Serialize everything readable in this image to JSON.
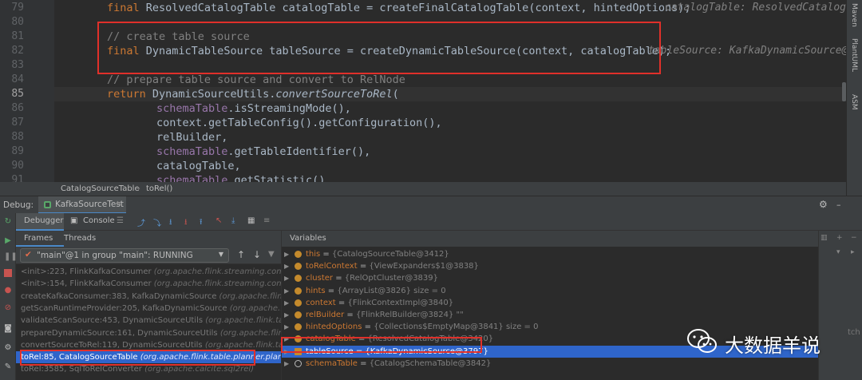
{
  "editor": {
    "lines": [
      {
        "num": "79",
        "indent": 0,
        "tokens": [
          [
            "k",
            "final "
          ],
          [
            "t",
            "ResolvedCatalogTable catalogTable = createFinalCatalogTable(context, hintedOptions);"
          ]
        ]
      },
      {
        "num": "80",
        "indent": 0,
        "tokens": []
      },
      {
        "num": "81",
        "indent": 0,
        "tokens": [
          [
            "c",
            "// create table source"
          ]
        ]
      },
      {
        "num": "82",
        "indent": 0,
        "tokens": [
          [
            "k",
            "final "
          ],
          [
            "t",
            "DynamicTableSource tableSource = createDynamicTableSource(context, catalogTable);"
          ]
        ]
      },
      {
        "num": "83",
        "indent": 0,
        "tokens": []
      },
      {
        "num": "84",
        "indent": 0,
        "tokens": [
          [
            "c",
            "// prepare table source and convert to RelNode"
          ]
        ]
      },
      {
        "num": "85",
        "indent": 0,
        "tokens": [
          [
            "k",
            "return "
          ],
          [
            "t",
            "DynamicSourceUtils."
          ],
          [
            "it",
            "convertSourceToRel"
          ],
          [
            "t",
            "("
          ]
        ]
      },
      {
        "num": "86",
        "indent": 1,
        "tokens": [
          [
            "pv",
            "schemaTable"
          ],
          [
            "t",
            ".isStreamingMode(),"
          ]
        ]
      },
      {
        "num": "87",
        "indent": 1,
        "tokens": [
          [
            "t",
            "context.getTableConfig().getConfiguration(),"
          ]
        ]
      },
      {
        "num": "88",
        "indent": 1,
        "tokens": [
          [
            "t",
            "relBuilder,"
          ]
        ]
      },
      {
        "num": "89",
        "indent": 1,
        "tokens": [
          [
            "pv",
            "schemaTable"
          ],
          [
            "t",
            ".getTableIdentifier(),"
          ]
        ]
      },
      {
        "num": "90",
        "indent": 1,
        "tokens": [
          [
            "t",
            "catalogTable,"
          ]
        ]
      },
      {
        "num": "91",
        "indent": 1,
        "tokens": [
          [
            "pv",
            "schemaTable"
          ],
          [
            "t",
            ".getStatistic()"
          ]
        ]
      }
    ],
    "current_line": "85",
    "hint_79": "catalogTable: ResolvedCatalogTa",
    "hint_82": "tableSource: KafkaDynamicSource@37",
    "breadcrumb_class": "CatalogSourceTable",
    "breadcrumb_method": "toRel()",
    "right_tools": [
      "Maven",
      "PlantUML",
      "ASM"
    ]
  },
  "debug": {
    "label": "Debug:",
    "session_tab": "KafkaSourceTest",
    "tab_debugger": "Debugger",
    "tab_console": "Console",
    "frames_tab": "Frames",
    "threads_tab": "Threads",
    "thread_selector": "\"main\"@1 in group \"main\": RUNNING",
    "variables_title": "Variables",
    "right_label": "tch"
  },
  "frames": [
    {
      "loc": "<init>:223, FlinkKafkaConsumer",
      "pkg": "(org.apache.flink.streaming.connect"
    },
    {
      "loc": "<init>:154, FlinkKafkaConsumer",
      "pkg": "(org.apache.flink.streaming.connect"
    },
    {
      "loc": "createKafkaConsumer:383, KafkaDynamicSource",
      "pkg": "(org.apache.flink.s"
    },
    {
      "loc": "getScanRuntimeProvider:205, KafkaDynamicSource",
      "pkg": "(org.apache.flink.s"
    },
    {
      "loc": "validateScanSource:453, DynamicSourceUtils",
      "pkg": "(org.apache.flink.tabl"
    },
    {
      "loc": "prepareDynamicSource:161, DynamicSourceUtils",
      "pkg": "(org.apache.flink.ta"
    },
    {
      "loc": "convertSourceToRel:119, DynamicSourceUtils",
      "pkg": "(org.apache.flink.tabl"
    },
    {
      "loc": "toRel:85, CatalogSourceTable",
      "pkg": "(org.apache.flink.table.planner.plan.sc"
    },
    {
      "loc": "toRel:3585, SqlToRelConverter",
      "pkg": "(org.apache.calcite.sql2rel)"
    }
  ],
  "selected_frame": 7,
  "variables": [
    {
      "name": "this",
      "value": "{CatalogSourceTable@3412}",
      "icon": "field"
    },
    {
      "name": "toRelContext",
      "value": "{ViewExpanders$1@3838}",
      "icon": "param"
    },
    {
      "name": "cluster",
      "value": "{RelOptCluster@3839}",
      "icon": "field"
    },
    {
      "name": "hints",
      "value": "{ArrayList@3826}  size = 0",
      "icon": "field"
    },
    {
      "name": "context",
      "value": "{FlinkContextImpl@3840}",
      "icon": "field"
    },
    {
      "name": "relBuilder",
      "value": "{FlinkRelBuilder@3824} \"\"",
      "icon": "field"
    },
    {
      "name": "hintedOptions",
      "value": "{Collections$EmptyMap@3841}  size = 0",
      "icon": "field"
    },
    {
      "name": "catalogTable",
      "value": "{ResolvedCatalogTable@3420}",
      "icon": "field"
    },
    {
      "name": "tableSource",
      "value": "{KafkaDynamicSource@3797}",
      "icon": "list"
    },
    {
      "name": "schemaTable",
      "value": "{CatalogSchemaTable@3842}",
      "icon": "link"
    }
  ],
  "selected_variable": 8,
  "watermark": {
    "text": "大数据羊说"
  },
  "colors": {
    "keyword": "#cc7832",
    "comment": "#808080",
    "selection": "#2f65ca",
    "highlight_box": "#e0302a"
  }
}
